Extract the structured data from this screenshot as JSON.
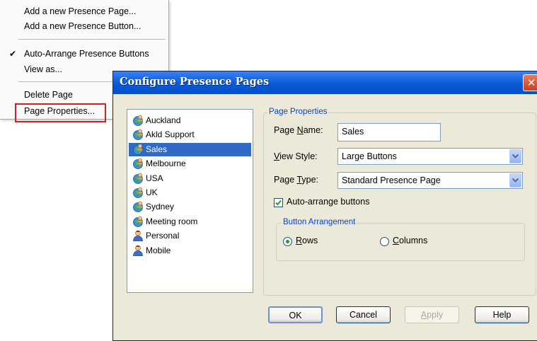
{
  "context_menu": {
    "items": [
      {
        "label": "Add a new Presence Page..."
      },
      {
        "label": "Add a new Presence Button..."
      },
      {
        "label": "Auto-Arrange Presence Buttons",
        "checked": true
      },
      {
        "label": "View as..."
      },
      {
        "label": "Delete Page"
      },
      {
        "label": "Page Properties..."
      }
    ],
    "check_mark": "✔"
  },
  "dialog": {
    "title": "Configure Presence Pages",
    "close_glyph": "✕",
    "pages": [
      {
        "label": "Auckland",
        "icon": "globe-person-icon"
      },
      {
        "label": "Akld Support",
        "icon": "globe-person-icon"
      },
      {
        "label": "Sales",
        "icon": "globe-person-icon",
        "selected": true
      },
      {
        "label": "Melbourne",
        "icon": "globe-person-icon"
      },
      {
        "label": "USA",
        "icon": "globe-person-icon"
      },
      {
        "label": "UK",
        "icon": "globe-person-icon"
      },
      {
        "label": "Sydney",
        "icon": "globe-person-icon"
      },
      {
        "label": "Meeting room",
        "icon": "globe-person-icon"
      },
      {
        "label": "Personal",
        "icon": "person-icon"
      },
      {
        "label": "Mobile",
        "icon": "person-icon"
      }
    ],
    "page_properties": {
      "legend": "Page Properties",
      "page_name_label": {
        "pre": "Page ",
        "key": "N",
        "post": "ame:"
      },
      "page_name_value": "Sales",
      "view_style_label": {
        "pre": "",
        "key": "V",
        "post": "iew Style:"
      },
      "view_style_value": "Large Buttons",
      "page_type_label": {
        "pre": "Page ",
        "key": "T",
        "post": "ype:"
      },
      "page_type_value": "Standard Presence Page",
      "auto_arrange_label": "Auto-arrange buttons",
      "auto_arrange_checked": true,
      "button_arrangement": {
        "legend": "Button Arrangement",
        "rows_label": {
          "key": "R",
          "post": "ows"
        },
        "columns_label": {
          "key": "C",
          "post": "olumns"
        },
        "selected": "Rows"
      }
    },
    "buttons": {
      "ok": "OK",
      "cancel": "Cancel",
      "apply": {
        "key": "A",
        "post": "pply"
      },
      "help": "Help"
    }
  },
  "colors": {
    "title_bar": "#0a5ad8",
    "selection": "#316ac5",
    "group_legend": "#0046d5",
    "highlight_box": "#d21f1f"
  }
}
